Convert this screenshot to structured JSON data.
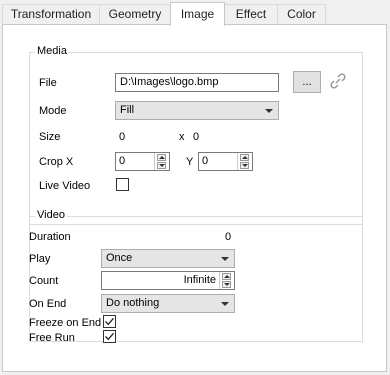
{
  "tabs": [
    "Transformation",
    "Geometry",
    "Image",
    "Effect",
    "Color"
  ],
  "active_tab": "Image",
  "media": {
    "title": "Media",
    "file_label": "File",
    "file_value": "D:\\Images\\logo.bmp",
    "browse_label": "...",
    "mode_label": "Mode",
    "mode_value": "Fill",
    "size_label": "Size",
    "size_w": "0",
    "size_x": "x",
    "size_h": "0",
    "crop_label": "Crop X",
    "crop_x": "0",
    "crop_y_label": "Y",
    "crop_y": "0",
    "live_label": "Live Video",
    "live_checked": false
  },
  "video": {
    "title": "Video",
    "duration_label": "Duration",
    "duration_value": "0",
    "play_label": "Play",
    "play_value": "Once",
    "count_label": "Count",
    "count_value": "Infinite",
    "onend_label": "On End",
    "onend_value": "Do nothing",
    "freeze_label": "Freeze on End",
    "freeze_checked": true,
    "freerun_label": "Free Run",
    "freerun_checked": true
  }
}
